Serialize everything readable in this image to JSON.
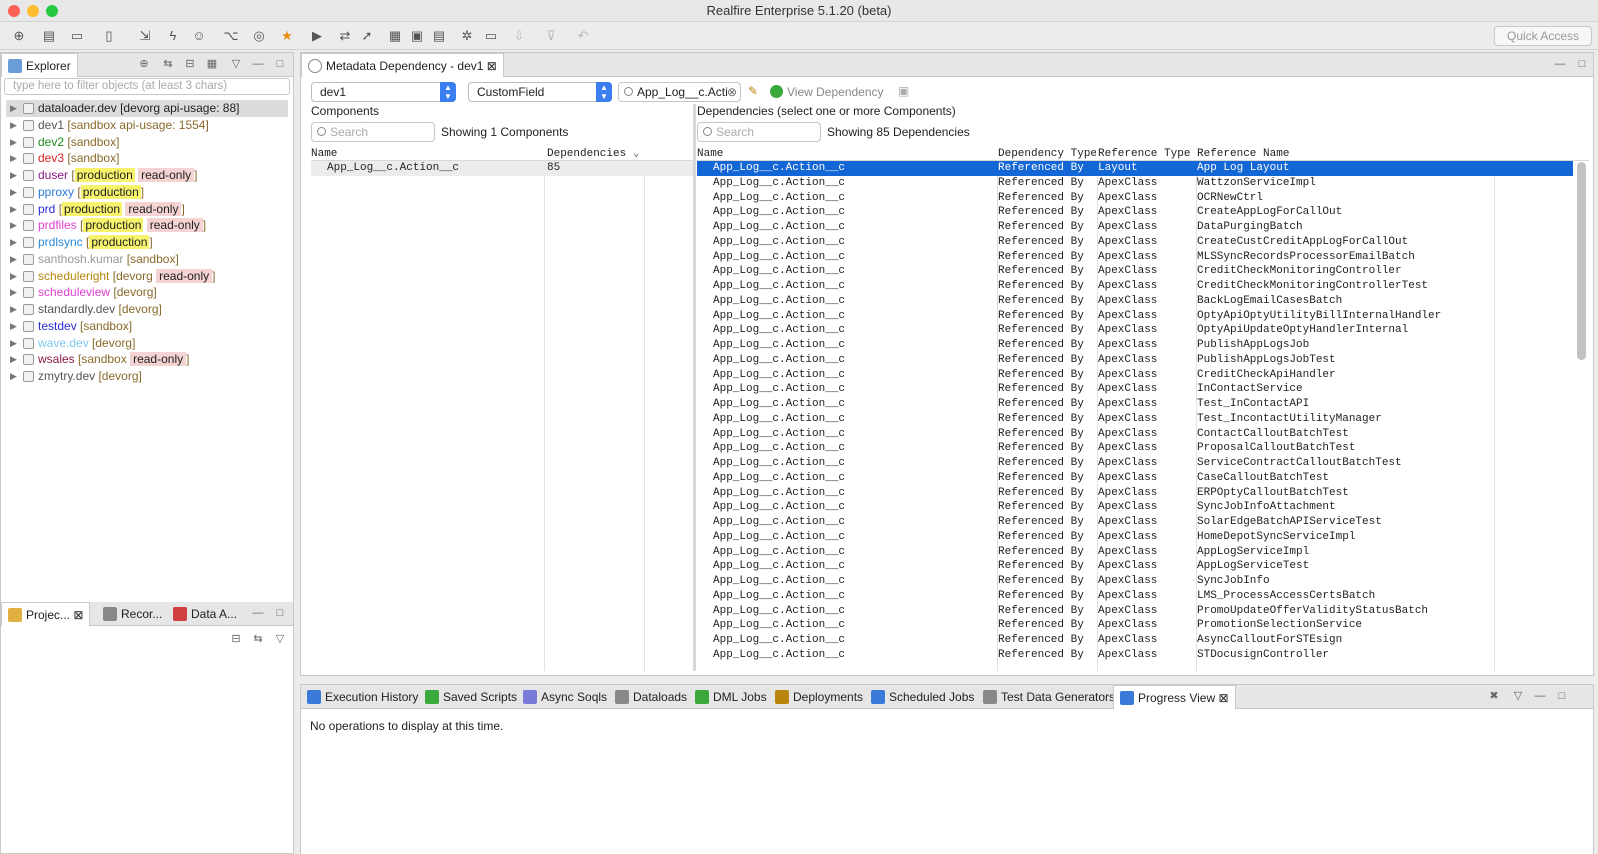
{
  "app": {
    "title": "Realfire Enterprise 5.1.20 (beta)",
    "quick_access": "Quick Access"
  },
  "explorer": {
    "tab": "Explorer",
    "filter_placeholder": "type here to filter objects (at least 3 chars)",
    "items": [
      {
        "name": "dataloader.dev",
        "name_color": "#222222",
        "meta": "[devorg api-usage: 88]",
        "selected": true
      },
      {
        "name": "dev1",
        "name_color": "#555555",
        "meta": "[sandbox api-usage: 1554]"
      },
      {
        "name": "dev2",
        "name_color": "#1a8a1a",
        "meta": "[sandbox]"
      },
      {
        "name": "dev3",
        "name_color": "#d42020",
        "meta": "[sandbox]"
      },
      {
        "name": "duser",
        "name_color": "#8a1a8a",
        "meta": "[",
        "tag1": "production",
        "tag2": "read-only",
        "meta_end": "]"
      },
      {
        "name": "pproxy",
        "name_color": "#2a7ad8",
        "meta": "[",
        "tag1": "production",
        "meta_end": "]"
      },
      {
        "name": "prd",
        "name_color": "#2a2ad8",
        "meta": "[",
        "tag1": "production",
        "tag2": "read-only",
        "meta_end": "]"
      },
      {
        "name": "prdfiles",
        "name_color": "#e040d0",
        "meta": "[",
        "tag1": "production",
        "tag2": "read-only",
        "meta_end": "]"
      },
      {
        "name": "prdlsync",
        "name_color": "#2a8ad8",
        "meta": "[",
        "tag1": "production",
        "meta_end": "]"
      },
      {
        "name": "santhosh.kumar",
        "name_color": "#999999",
        "meta": "[sandbox]"
      },
      {
        "name": "scheduleright",
        "name_color": "#b8860b",
        "meta": "[devorg",
        "tag2": "read-only",
        "meta_end": "]"
      },
      {
        "name": "scheduleview",
        "name_color": "#e040d0",
        "meta": "[devorg]"
      },
      {
        "name": "standardly.dev",
        "name_color": "#555555",
        "meta": "[devorg]"
      },
      {
        "name": "testdev",
        "name_color": "#2a2ad8",
        "meta": "[sandbox]"
      },
      {
        "name": "wave.dev",
        "name_color": "#7ec8f0",
        "meta": "[devorg]"
      },
      {
        "name": "wsales",
        "name_color": "#8a1a4a",
        "meta": "[sandbox",
        "tag2": "read-only",
        "meta_end": "]"
      },
      {
        "name": "zmytry.dev",
        "name_color": "#555555",
        "meta": "[devorg]"
      }
    ]
  },
  "bottom_left_tabs": [
    "Projec...",
    "Recor...",
    "Data A..."
  ],
  "editor": {
    "tab": "Metadata Dependency - dev1",
    "org_select": "dev1",
    "type_select": "CustomField",
    "component_search": "App_Log__c.Acti",
    "view_dependency": "View Dependency",
    "components_label": "Components",
    "search_placeholder": "Search",
    "showing_components": "Showing 1 Components",
    "dependencies_label": "Dependencies (select one or more Components)",
    "showing_dependencies": "Showing 85 Dependencies",
    "comp_headers": [
      "Name",
      "Dependencies"
    ],
    "components": [
      {
        "name": "App_Log__c.Action__c",
        "deps": "85"
      }
    ],
    "dep_headers": [
      "Name",
      "Dependency Type",
      "Reference Type",
      "Reference Name"
    ],
    "dependencies": [
      [
        "App_Log__c.Action__c",
        "Referenced By",
        "Layout",
        "App Log Layout"
      ],
      [
        "App_Log__c.Action__c",
        "Referenced By",
        "ApexClass",
        "WattzonServiceImpl"
      ],
      [
        "App_Log__c.Action__c",
        "Referenced By",
        "ApexClass",
        "OCRNewCtrl"
      ],
      [
        "App_Log__c.Action__c",
        "Referenced By",
        "ApexClass",
        "CreateAppLogForCallOut"
      ],
      [
        "App_Log__c.Action__c",
        "Referenced By",
        "ApexClass",
        "DataPurgingBatch"
      ],
      [
        "App_Log__c.Action__c",
        "Referenced By",
        "ApexClass",
        "CreateCustCreditAppLogForCallOut"
      ],
      [
        "App_Log__c.Action__c",
        "Referenced By",
        "ApexClass",
        "MLSSyncRecordsProcessorEmailBatch"
      ],
      [
        "App_Log__c.Action__c",
        "Referenced By",
        "ApexClass",
        "CreditCheckMonitoringController"
      ],
      [
        "App_Log__c.Action__c",
        "Referenced By",
        "ApexClass",
        "CreditCheckMonitoringControllerTest"
      ],
      [
        "App_Log__c.Action__c",
        "Referenced By",
        "ApexClass",
        "BackLogEmailCasesBatch"
      ],
      [
        "App_Log__c.Action__c",
        "Referenced By",
        "ApexClass",
        "OptyApiOptyUtilityBillInternalHandler"
      ],
      [
        "App_Log__c.Action__c",
        "Referenced By",
        "ApexClass",
        "OptyApiUpdateOptyHandlerInternal"
      ],
      [
        "App_Log__c.Action__c",
        "Referenced By",
        "ApexClass",
        "PublishAppLogsJob"
      ],
      [
        "App_Log__c.Action__c",
        "Referenced By",
        "ApexClass",
        "PublishAppLogsJobTest"
      ],
      [
        "App_Log__c.Action__c",
        "Referenced By",
        "ApexClass",
        "CreditCheckApiHandler"
      ],
      [
        "App_Log__c.Action__c",
        "Referenced By",
        "ApexClass",
        "InContactService"
      ],
      [
        "App_Log__c.Action__c",
        "Referenced By",
        "ApexClass",
        "Test_InContactAPI"
      ],
      [
        "App_Log__c.Action__c",
        "Referenced By",
        "ApexClass",
        "Test_IncontactUtilityManager"
      ],
      [
        "App_Log__c.Action__c",
        "Referenced By",
        "ApexClass",
        "ContactCalloutBatchTest"
      ],
      [
        "App_Log__c.Action__c",
        "Referenced By",
        "ApexClass",
        "ProposalCalloutBatchTest"
      ],
      [
        "App_Log__c.Action__c",
        "Referenced By",
        "ApexClass",
        "ServiceContractCalloutBatchTest"
      ],
      [
        "App_Log__c.Action__c",
        "Referenced By",
        "ApexClass",
        "CaseCalloutBatchTest"
      ],
      [
        "App_Log__c.Action__c",
        "Referenced By",
        "ApexClass",
        "ERPOptyCalloutBatchTest"
      ],
      [
        "App_Log__c.Action__c",
        "Referenced By",
        "ApexClass",
        "SyncJobInfoAttachment"
      ],
      [
        "App_Log__c.Action__c",
        "Referenced By",
        "ApexClass",
        "SolarEdgeBatchAPIServiceTest"
      ],
      [
        "App_Log__c.Action__c",
        "Referenced By",
        "ApexClass",
        "HomeDepotSyncServiceImpl"
      ],
      [
        "App_Log__c.Action__c",
        "Referenced By",
        "ApexClass",
        "AppLogServiceImpl"
      ],
      [
        "App_Log__c.Action__c",
        "Referenced By",
        "ApexClass",
        "AppLogServiceTest"
      ],
      [
        "App_Log__c.Action__c",
        "Referenced By",
        "ApexClass",
        "SyncJobInfo"
      ],
      [
        "App_Log__c.Action__c",
        "Referenced By",
        "ApexClass",
        "LMS_ProcessAccessCertsBatch"
      ],
      [
        "App_Log__c.Action__c",
        "Referenced By",
        "ApexClass",
        "PromoUpdateOfferValidityStatusBatch"
      ],
      [
        "App_Log__c.Action__c",
        "Referenced By",
        "ApexClass",
        "PromotionSelectionService"
      ],
      [
        "App_Log__c.Action__c",
        "Referenced By",
        "ApexClass",
        "AsyncCalloutForSTEsign"
      ],
      [
        "App_Log__c.Action__c",
        "Referenced By",
        "ApexClass",
        "STDocusignController"
      ]
    ]
  },
  "bottom_tabs": [
    "Execution History",
    "Saved Scripts",
    "Async Soqls",
    "Dataloads",
    "DML Jobs",
    "Deployments",
    "Scheduled Jobs",
    "Test Data Generators",
    "Progress View"
  ],
  "progress_message": "No operations to display at this time.",
  "colors": {
    "selection": "#1366d6",
    "accent": "#3b7ef0",
    "production": "#f8f36c",
    "readonly": "#f5d3d3"
  }
}
